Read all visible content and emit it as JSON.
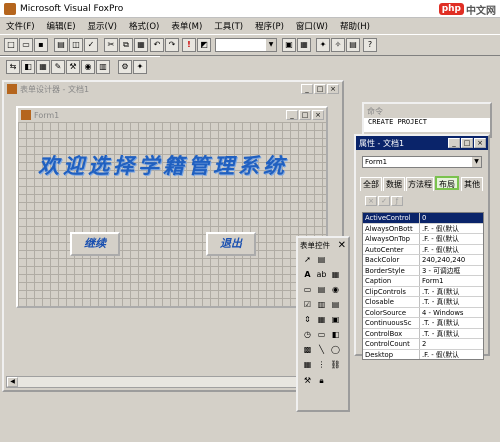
{
  "app": {
    "title": "Microsoft Visual FoxPro"
  },
  "watermark": {
    "logo": "php",
    "text": "中文网"
  },
  "menu": [
    "文件(F)",
    "编辑(E)",
    "显示(V)",
    "格式(O)",
    "表单(M)",
    "工具(T)",
    "程序(P)",
    "窗口(W)",
    "帮助(H)"
  ],
  "toolbar": {
    "combo_value": ""
  },
  "form_designer": {
    "title": "表单设计器 - 文档1",
    "form_title": "Form1",
    "heading": "欢迎选择学籍管理系统",
    "continue_label": "继续",
    "exit_label": "退出"
  },
  "command_window": {
    "title": "命令",
    "content": "CREATE PROJECT"
  },
  "properties": {
    "title": "属性 - 文档1",
    "object": "Form1",
    "tabs": [
      "全部",
      "数据",
      "方法程",
      "布局",
      "其他"
    ],
    "rows": [
      {
        "name": "ActiveControl",
        "value": "0"
      },
      {
        "name": "AlwaysOnBott",
        "value": ".F. - 假(默认"
      },
      {
        "name": "AlwaysOnTop",
        "value": ".F. - 假(默认"
      },
      {
        "name": "AutoCenter",
        "value": ".F. - 假(默认"
      },
      {
        "name": "BackColor",
        "value": "240,240,240"
      },
      {
        "name": "BorderStyle",
        "value": "3 - 可调边框"
      },
      {
        "name": "Caption",
        "value": "Form1"
      },
      {
        "name": "ClipControls",
        "value": ".T. - 真(默认"
      },
      {
        "name": "Closable",
        "value": ".T. - 真(默认"
      },
      {
        "name": "ColorSource",
        "value": "4 - Windows"
      },
      {
        "name": "ContinuousSc",
        "value": ".T. - 真(默认"
      },
      {
        "name": "ControlBox",
        "value": ".T. - 真(默认"
      },
      {
        "name": "ControlCount",
        "value": "2"
      },
      {
        "name": "Desktop",
        "value": ".F. - 假(默认"
      }
    ]
  },
  "form_controls": {
    "title": "表单控件"
  }
}
